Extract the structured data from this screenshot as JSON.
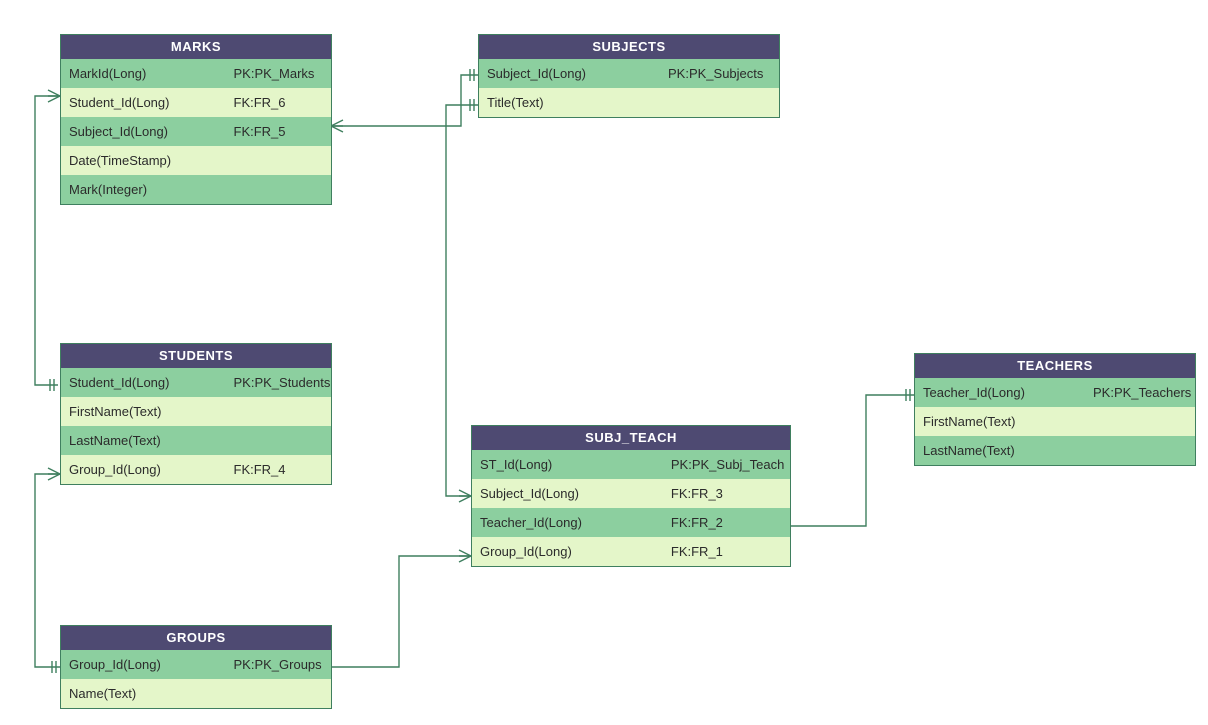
{
  "entities": {
    "marks": {
      "title": "MARKS",
      "rows": [
        {
          "field": "MarkId(Long)",
          "key": "PK:PK_Marks"
        },
        {
          "field": "Student_Id(Long)",
          "key": "FK:FR_6"
        },
        {
          "field": "Subject_Id(Long)",
          "key": "FK:FR_5"
        },
        {
          "field": "Date(TimeStamp)",
          "key": ""
        },
        {
          "field": "Mark(Integer)",
          "key": ""
        }
      ]
    },
    "subjects": {
      "title": "SUBJECTS",
      "rows": [
        {
          "field": "Subject_Id(Long)",
          "key": "PK:PK_Subjects"
        },
        {
          "field": "Title(Text)",
          "key": ""
        }
      ]
    },
    "students": {
      "title": "STUDENTS",
      "rows": [
        {
          "field": "Student_Id(Long)",
          "key": "PK:PK_Students"
        },
        {
          "field": "FirstName(Text)",
          "key": ""
        },
        {
          "field": "LastName(Text)",
          "key": ""
        },
        {
          "field": "Group_Id(Long)",
          "key": "FK:FR_4"
        }
      ]
    },
    "subj_teach": {
      "title": "SUBJ_TEACH",
      "rows": [
        {
          "field": "ST_Id(Long)",
          "key": "PK:PK_Subj_Teach"
        },
        {
          "field": "Subject_Id(Long)",
          "key": "FK:FR_3"
        },
        {
          "field": "Teacher_Id(Long)",
          "key": "FK:FR_2"
        },
        {
          "field": "Group_Id(Long)",
          "key": "FK:FR_1"
        }
      ]
    },
    "teachers": {
      "title": "TEACHERS",
      "rows": [
        {
          "field": "Teacher_Id(Long)",
          "key": "PK:PK_Teachers"
        },
        {
          "field": "FirstName(Text)",
          "key": ""
        },
        {
          "field": "LastName(Text)",
          "key": ""
        }
      ]
    },
    "groups": {
      "title": "GROUPS",
      "rows": [
        {
          "field": "Group_Id(Long)",
          "key": "PK:PK_Groups"
        },
        {
          "field": "Name(Text)",
          "key": ""
        }
      ]
    }
  }
}
